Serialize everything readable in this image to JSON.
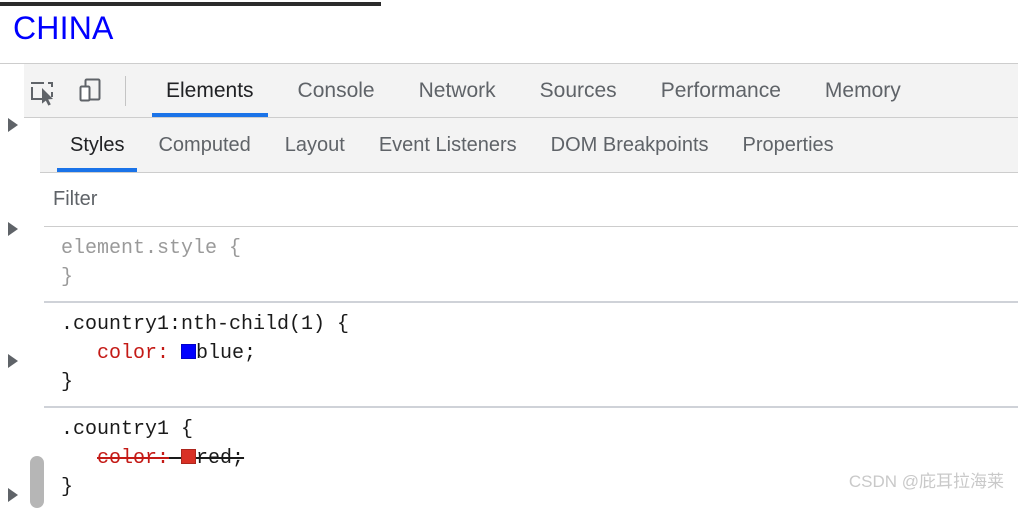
{
  "page_preview": {
    "heading": "CHINA",
    "heading_color": "#0000ff"
  },
  "devtools": {
    "toolbar": {
      "inspect_icon": "inspect-element-icon",
      "device_icon": "device-toolbar-icon",
      "tabs": [
        {
          "label": "Elements",
          "selected": true
        },
        {
          "label": "Console",
          "selected": false
        },
        {
          "label": "Network",
          "selected": false
        },
        {
          "label": "Sources",
          "selected": false
        },
        {
          "label": "Performance",
          "selected": false
        },
        {
          "label": "Memory",
          "selected": false
        }
      ]
    },
    "sub_toolbar": {
      "tabs": [
        {
          "label": "Styles",
          "selected": true
        },
        {
          "label": "Computed",
          "selected": false
        },
        {
          "label": "Layout",
          "selected": false
        },
        {
          "label": "Event Listeners",
          "selected": false
        },
        {
          "label": "DOM Breakpoints",
          "selected": false
        },
        {
          "label": "Properties",
          "selected": false
        }
      ]
    },
    "styles_pane": {
      "filter": {
        "placeholder": "Filter",
        "value": ""
      },
      "rules": [
        {
          "selector": "element.style {",
          "close": "}",
          "dim": true,
          "declarations": []
        },
        {
          "selector": ".country1:nth-child(1) {",
          "close": "}",
          "dim": false,
          "declarations": [
            {
              "name": "color:",
              "value": "blue;",
              "swatch": "#0000ff",
              "overridden": false
            }
          ]
        },
        {
          "selector": ".country1 {",
          "close": "}",
          "dim": false,
          "declarations": [
            {
              "name": "color:",
              "value": "red;",
              "swatch": "#d93025",
              "overridden": true
            }
          ]
        }
      ]
    },
    "accent_color": "#1a73e8"
  },
  "watermark": "CSDN @庇耳拉海莱"
}
